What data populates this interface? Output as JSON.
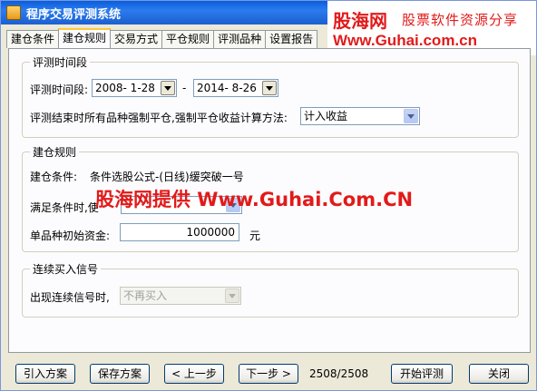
{
  "window": {
    "title": "程序交易评测系统"
  },
  "watermark": {
    "brand": "股海网",
    "slogan": "股票软件资源分享",
    "url": "Www.Guhai.com.cn",
    "overlay": "股海网提供 Www.Guhai.Com.CN"
  },
  "tabs": [
    "建仓条件",
    "建仓规则",
    "交易方式",
    "平仓规则",
    "评测品种",
    "设置报告"
  ],
  "active_tab": "建仓规则",
  "period_group": {
    "title": "评测时间段",
    "range_label": "评测时间段:",
    "start_date": "2008- 1-28",
    "separator": "-",
    "end_date": "2014- 8-26",
    "force_close_label": "评测结束时所有品种强制平仓,强制平仓收益计算方法:",
    "force_close_method": "计入收益"
  },
  "rule_group": {
    "title": "建仓规则",
    "condition_label": "建仓条件:",
    "condition_value": "条件选股公式-(日线)缓突破一号",
    "satisfy_label": "满足条件时,使",
    "satisfy_value": "",
    "capital_label": "单品种初始资金:",
    "capital_value": "1000000",
    "capital_unit": "元"
  },
  "signal_group": {
    "title": "连续买入信号",
    "label": "出现连续信号时,",
    "value": "不再买入"
  },
  "footer": {
    "import_label": "引入方案",
    "save_label": "保存方案",
    "prev_label": "< 上一步",
    "next_label": "下一步 >",
    "counter": "2508/2508",
    "start_label": "开始评测",
    "close_label": "关闭"
  }
}
